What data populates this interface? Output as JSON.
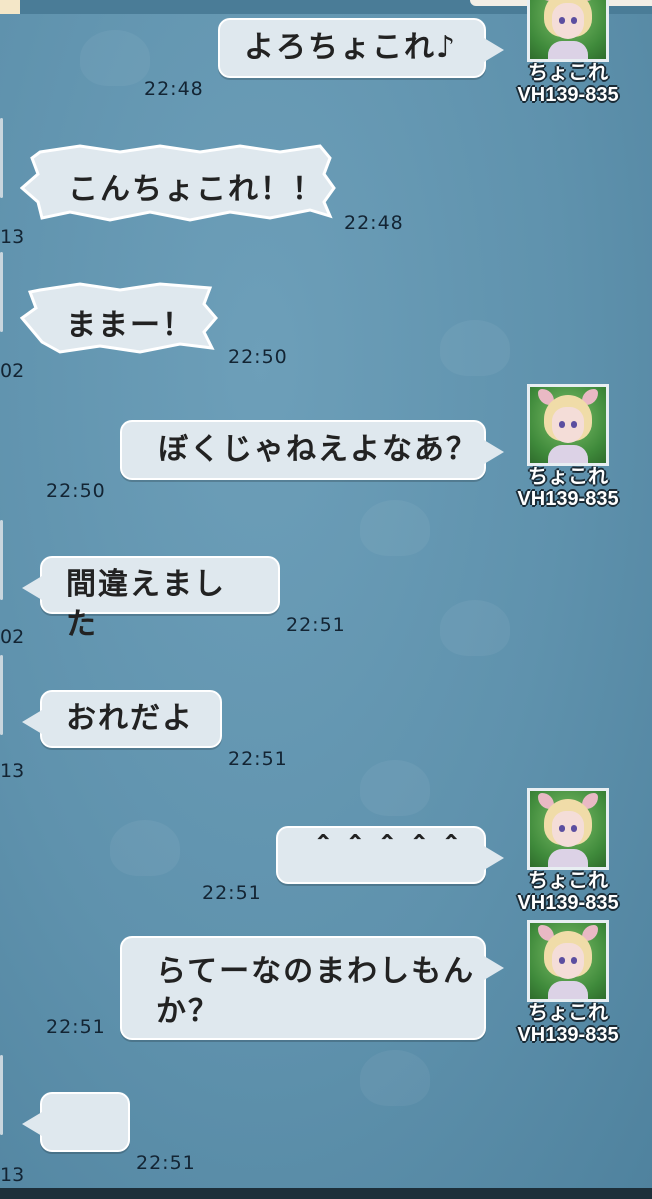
{
  "chat": {
    "self": {
      "name": "ちょこれ",
      "id": "VH139-835"
    },
    "messages": [
      {
        "text": "よろちょこれ♪",
        "time": "22:48"
      },
      {
        "text": "こんちょこれ！！",
        "time": "22:48",
        "edge": "13"
      },
      {
        "text": "ままー！",
        "time": "22:50",
        "edge": "02"
      },
      {
        "text": "ぼくじゃねえよなあ？",
        "time": "22:50"
      },
      {
        "text": "間違えました",
        "time": "22:51",
        "edge": "02"
      },
      {
        "text": "おれだよ",
        "time": "22:51",
        "edge": "13"
      },
      {
        "text": "＾＾＾＾＾",
        "time": "22:51"
      },
      {
        "text": "らてーなのまわしもん",
        "text2": "か？",
        "time": "22:51"
      },
      {
        "text": "",
        "time": "22:51",
        "edge": "13"
      }
    ]
  }
}
